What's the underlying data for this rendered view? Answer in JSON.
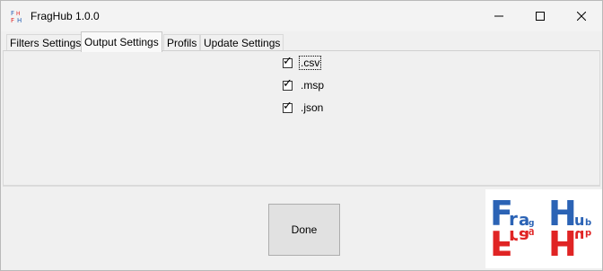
{
  "window": {
    "title": "FragHub 1.0.0",
    "controls": {
      "minimize": "minimize-icon",
      "maximize": "maximize-icon",
      "close": "close-icon"
    }
  },
  "tabs": [
    {
      "label": "Filters Settings",
      "active": false
    },
    {
      "label": "Output Settings",
      "active": true
    },
    {
      "label": "Profils",
      "active": false
    },
    {
      "label": "Update Settings",
      "active": false
    }
  ],
  "output_settings": {
    "options": [
      {
        "label": ".csv",
        "checked": true
      },
      {
        "label": ".msp",
        "checked": true
      },
      {
        "label": ".json",
        "checked": true
      }
    ]
  },
  "footer": {
    "done_label": "Done",
    "logo": {
      "icon": "fraghub-logo",
      "text": "FragHub",
      "colors": {
        "blue": "#2b63b5",
        "red": "#e02424"
      }
    }
  }
}
